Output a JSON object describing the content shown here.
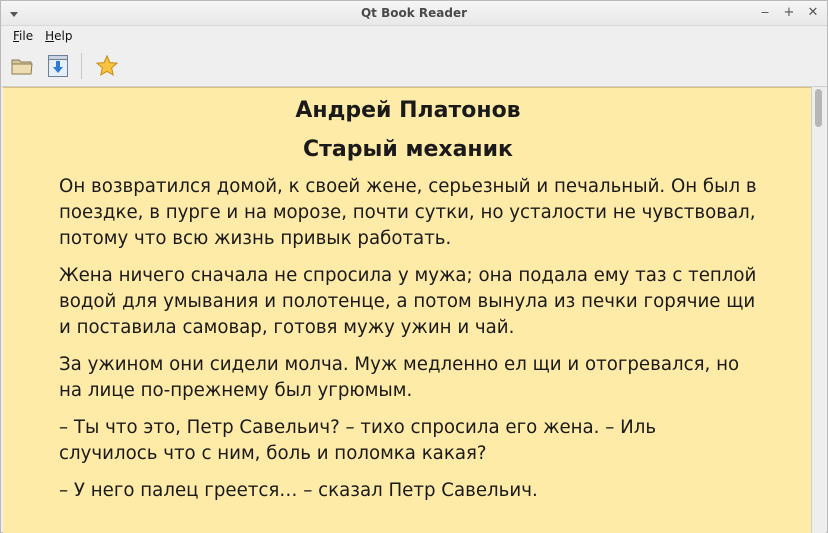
{
  "window": {
    "title": "Qt Book Reader",
    "controls": {
      "minimize": "‒",
      "maximize": "+",
      "close": "✕"
    }
  },
  "menubar": {
    "items": [
      {
        "label_first": "F",
        "label_rest": "ile"
      },
      {
        "label_first": "H",
        "label_rest": "elp"
      }
    ]
  },
  "toolbar": {
    "buttons": [
      {
        "icon": "folder-open-icon"
      },
      {
        "icon": "download-icon"
      },
      {
        "icon": "star-icon"
      }
    ]
  },
  "book": {
    "author": "Андрей Платонов",
    "title": "Старый механик",
    "paragraphs": [
      "Он возвратился домой, к своей жене, серьезный и печальный. Он был в поездке, в пурге и на морозе, почти сутки, но усталости не чувствовал, потому что всю жизнь привык работать.",
      "Жена ничего сначала не спросила у мужа; она подала ему таз с теплой водой для умывания и полотенце, а потом вынула из печки горячие щи и поставила самовар, готовя мужу ужин и чай.",
      "За ужином они сидели молча. Муж медленно ел щи и отогревался, но на лице по-прежнему был угрюмым.",
      "– Ты что это, Петр Савельич? – тихо спросила его жена. – Иль случилось что с ним, боль и поломка какая?",
      "– У него палец греется… – сказал Петр Савельич."
    ]
  },
  "colors": {
    "page_background": "#ffeba8",
    "text": "#1a1a1a"
  }
}
